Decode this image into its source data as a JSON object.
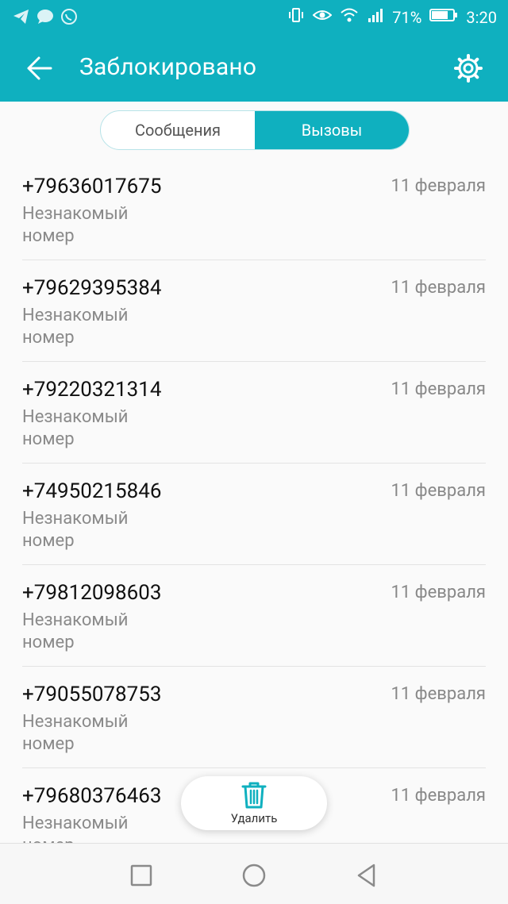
{
  "status_bar": {
    "battery_percent": "71%",
    "time": "3:20",
    "left_icons": [
      "telegram-icon",
      "chat-bubble-icon",
      "whatsapp-icon"
    ],
    "right_icons": [
      "vibrate-icon",
      "eye-icon",
      "wifi-icon",
      "signal-icon",
      "battery-icon"
    ]
  },
  "app_bar": {
    "title": "Заблокировано",
    "back_icon": "arrow-left-icon",
    "settings_icon": "gear-icon",
    "color": "#0fb0bf"
  },
  "tabs": [
    {
      "label": "Сообщения",
      "active": false
    },
    {
      "label": "Вызовы",
      "active": true
    }
  ],
  "calls": [
    {
      "number": "+79636017675",
      "date": "11 февраля",
      "label": "Незнакомый номер"
    },
    {
      "number": "+79629395384",
      "date": "11 февраля",
      "label": "Незнакомый номер"
    },
    {
      "number": "+79220321314",
      "date": "11 февраля",
      "label": "Незнакомый номер"
    },
    {
      "number": "+74950215846",
      "date": "11 февраля",
      "label": "Незнакомый номер"
    },
    {
      "number": "+79812098603",
      "date": "11 февраля",
      "label": "Незнакомый номер"
    },
    {
      "number": "+79055078753",
      "date": "11 февраля",
      "label": "Незнакомый номер"
    },
    {
      "number": "+79680376463",
      "date": "11 февраля",
      "label": "Незнакомый номер"
    }
  ],
  "actions": {
    "delete_label": "Удалить",
    "delete_icon": "trash-icon"
  },
  "nav_bar": {
    "icons": [
      "recent-apps-icon",
      "home-icon",
      "back-icon"
    ]
  }
}
